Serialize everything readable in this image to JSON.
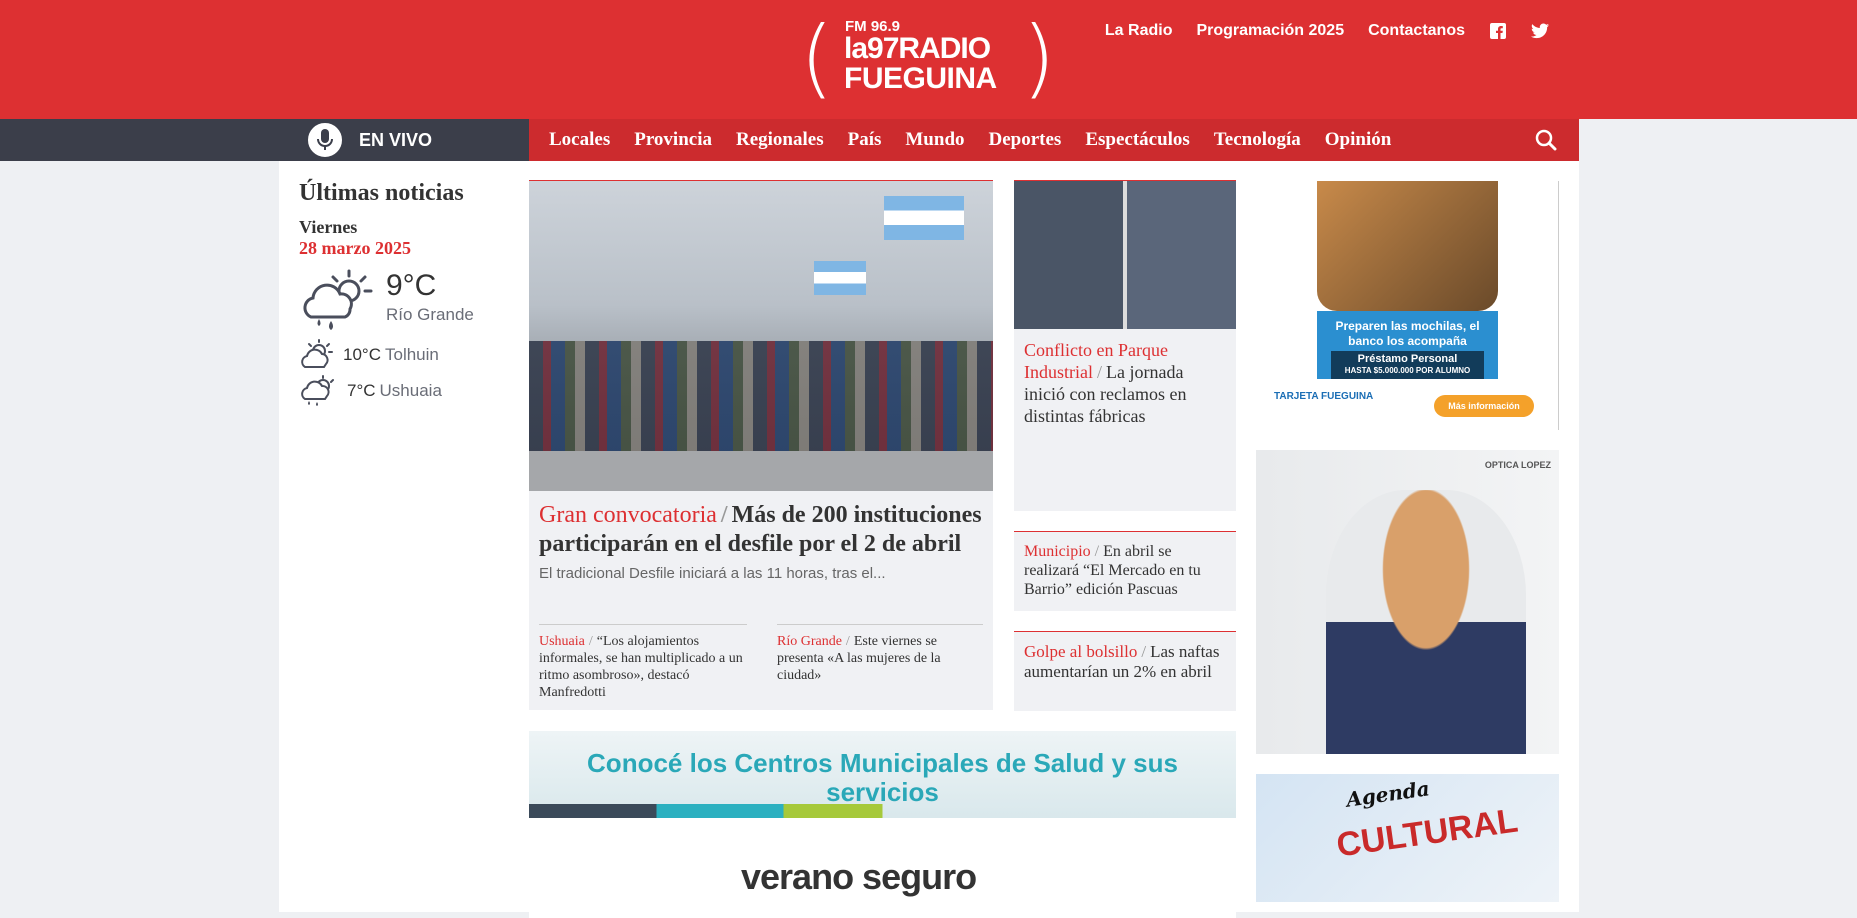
{
  "header": {
    "logo": {
      "fm": "FM 96.9",
      "line1": "la97RADIO",
      "line2": "FUEGUINA"
    },
    "links": [
      "La Radio",
      "Programación 2025",
      "Contactanos"
    ],
    "social": [
      "facebook-icon",
      "twitter-icon"
    ]
  },
  "nav": {
    "live_label": "EN VIVO",
    "items": [
      "Locales",
      "Provincia",
      "Regionales",
      "País",
      "Mundo",
      "Deportes",
      "Espectáculos",
      "Tecnología",
      "Opinión"
    ]
  },
  "sidebar": {
    "title": "Últimas noticias",
    "day": "Viernes",
    "date": "28 marzo 2025",
    "weather": {
      "main": {
        "temp": "9°C",
        "city": "Río Grande"
      },
      "others": [
        {
          "temp": "10°C",
          "city": "Tolhuin"
        },
        {
          "temp": "7°C",
          "city": "Ushuaia"
        }
      ]
    }
  },
  "featured": {
    "kicker": "Gran convocatoria",
    "title": "Más de 200 instituciones participarán en el desfile por el 2 de abril",
    "summary": "El tradicional Desfile iniciará a las 11 horas, tras el...",
    "subnews": [
      {
        "kicker": "Ushuaia",
        "title": "“Los alojamientos informales, se han multiplicado a un ritmo asombroso», destacó Manfredotti"
      },
      {
        "kicker": "Río Grande",
        "title": "Este viernes se presenta «A las mujeres de la ciudad»"
      }
    ]
  },
  "side_news": [
    {
      "kicker": "Conflicto en Parque Industrial",
      "title": "La jornada inició con reclamos en distintas fábricas"
    },
    {
      "kicker": "Municipio",
      "title": "En abril se realizará “El Mercado en tu Barrio” edición Pascuas"
    },
    {
      "kicker": "Golpe al bolsillo",
      "title": "Las naftas aumentarían un 2% en abril"
    }
  ],
  "ads": {
    "salud": "Conocé los Centros Municipales de Salud y sus servicios",
    "verano": "verano seguro",
    "tarjeta": {
      "headline": "Preparen las mochilas, el banco los acompaña",
      "loan": "Préstamo Personal",
      "loan_sub": "HASTA $5.000.000 POR ALUMNO",
      "brand": "TARJETA FUEGUINA",
      "button": "Más información"
    },
    "optica": "OPTICA LOPEZ",
    "agenda": {
      "line1": "Agenda",
      "line2": "CULTURAL"
    }
  }
}
